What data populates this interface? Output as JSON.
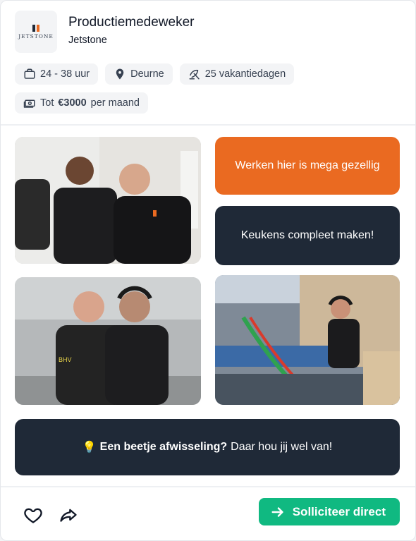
{
  "job": {
    "title": "Productiemedeweker",
    "company": "Jetstone",
    "logo_text": "JETSTONE"
  },
  "tags": {
    "hours": "24 - 38 uur",
    "location": "Deurne",
    "vacation": "25 vakantiedagen",
    "salary_prefix": "Tot",
    "salary_amount": "€3000",
    "salary_suffix": "per maand"
  },
  "highlights": {
    "fun": "Werken hier is mega gezellig",
    "task": "Keukens compleet maken!"
  },
  "banner": {
    "emoji": "💡",
    "bold": "Een beetje afwisseling?",
    "text": "Daar hou jij wel van!"
  },
  "footer": {
    "apply_label": "Solliciteer direct"
  },
  "photos": {
    "p1": "two smiling men at a white van",
    "p2": "two men talking in factory wearing ear protection",
    "p3": "woman with ear protection at production line"
  },
  "icons": [
    "briefcase-icon",
    "location-pin-icon",
    "beach-umbrella-icon",
    "money-icon",
    "heart-icon",
    "share-icon",
    "arrow-right-icon"
  ],
  "colors": {
    "accent_orange": "#ea6a21",
    "navy": "#1f2937",
    "cta_green": "#10b981",
    "chip_bg": "#f3f4f6"
  }
}
